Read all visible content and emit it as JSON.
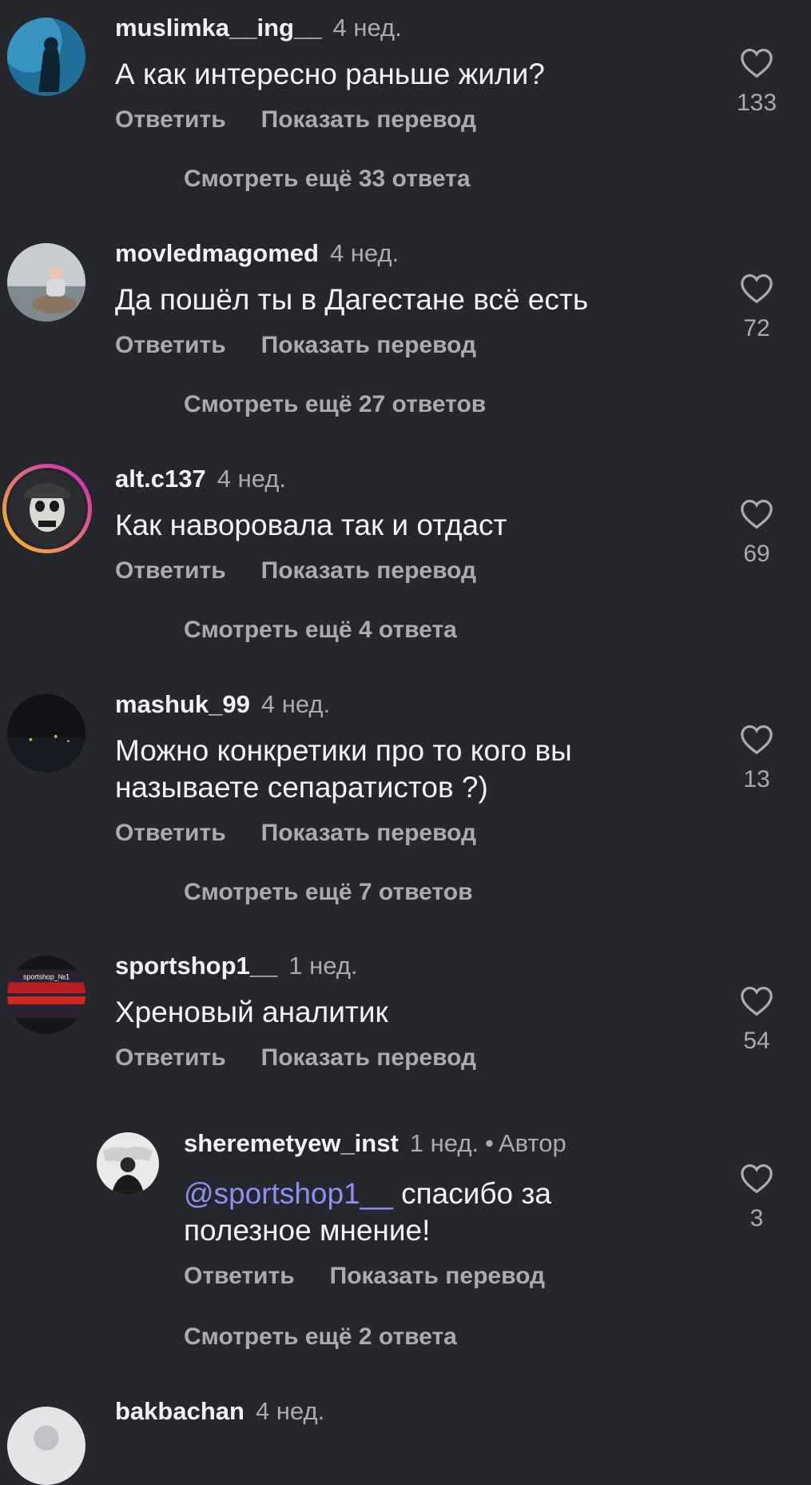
{
  "comments": [
    {
      "username": "muslimka__ing__",
      "time": "4 нед.",
      "text": "А как интересно  раньше  жили?",
      "reply_label": "Ответить",
      "translate_label": "Показать перевод",
      "likes": "133",
      "more_replies": "Смотреть ещё 33 ответа"
    },
    {
      "username": "movledmagomed",
      "time": "4 нед.",
      "text": "Да пошёл ты в Дагестане всё есть",
      "reply_label": "Ответить",
      "translate_label": "Показать перевод",
      "likes": "72",
      "more_replies": "Смотреть ещё 27 ответов"
    },
    {
      "username": "alt.c137",
      "time": "4 нед.",
      "text": "Как наворовала так и отдаст",
      "reply_label": "Ответить",
      "translate_label": "Показать перевод",
      "likes": "69",
      "more_replies": "Смотреть ещё 4 ответа"
    },
    {
      "username": "mashuk_99",
      "time": "4 нед.",
      "text": "Можно конкретики про то кого вы называете сепаратистов ?)",
      "reply_label": "Ответить",
      "translate_label": "Показать перевод",
      "likes": "13",
      "more_replies": "Смотреть ещё 7 ответов"
    },
    {
      "username": "sportshop1__",
      "time": "1 нед.",
      "text": "Хреновый аналитик",
      "reply_label": "Ответить",
      "translate_label": "Показать перевод",
      "likes": "54"
    }
  ],
  "reply": {
    "username": "sheremetyew_inst",
    "time": "1 нед.",
    "dot": "•",
    "author_label": "Автор",
    "mention": "@sportshop1__",
    "text": " спасибо за полезное мнение!",
    "reply_label": "Ответить",
    "translate_label": "Показать перевод",
    "likes": "3",
    "more_replies": "Смотреть ещё 2 ответа"
  },
  "last_comment": {
    "username": "bakbachan",
    "time": "4 нед."
  },
  "avatar_thumbnail_text": "sportshop_№1",
  "colors": {
    "background": "#25272d",
    "text": "#f2f2f4",
    "secondary": "#a9abb1",
    "mention": "#8e8ff2",
    "story_ring_start": "#f9c020",
    "story_ring_end": "#d020c8"
  },
  "icons": {
    "like": "heart-outline-icon"
  }
}
